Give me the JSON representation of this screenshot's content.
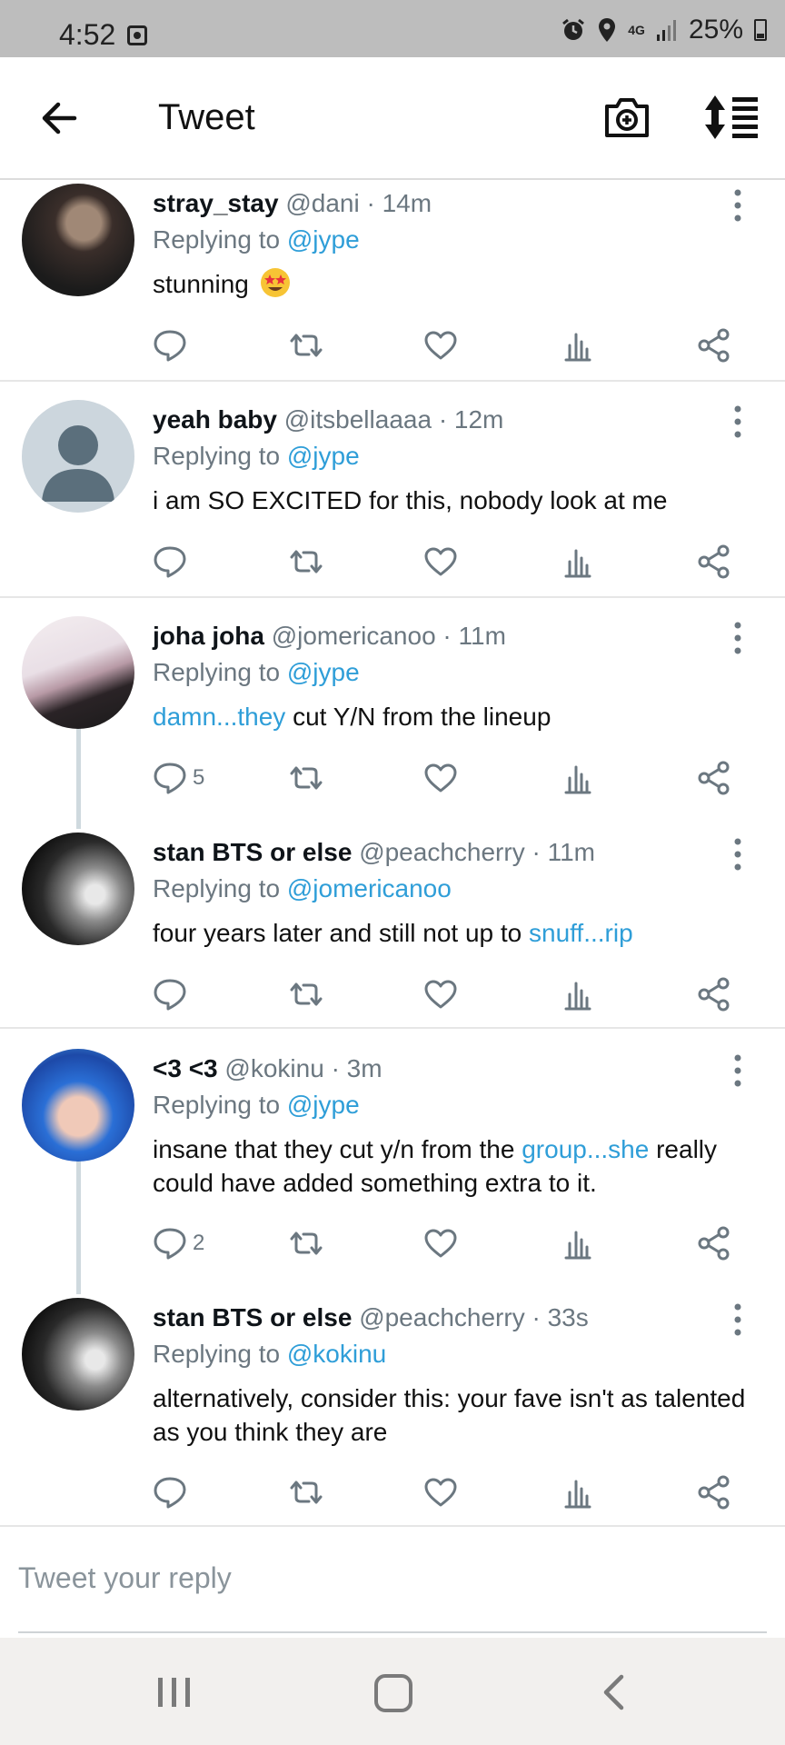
{
  "status_bar": {
    "time": "4:52",
    "network": "4G",
    "battery": "25%"
  },
  "header": {
    "title": "Tweet"
  },
  "tweets": [
    {
      "name": "stray_stay",
      "meta": "@dani · 14m",
      "replying_prefix": "Replying to ",
      "replying_to": "@jype",
      "text": "stunning",
      "emoji": "star-struck-emoji",
      "reply_count": ""
    },
    {
      "name": "yeah baby",
      "meta": "@itsbellaaaa · 12m",
      "replying_prefix": "Replying to ",
      "replying_to": "@jype",
      "text": "i am SO EXCITED for this, nobody look at me",
      "reply_count": ""
    },
    {
      "name": "joha joha",
      "meta": "@jomericanoo · 11m",
      "replying_prefix": "Replying to ",
      "replying_to": "@jype",
      "text_link": "damn...they",
      "text": " cut Y/N from the lineup",
      "reply_count": "5"
    },
    {
      "name": "stan BTS or else",
      "meta": "@peachcherry · 11m",
      "replying_prefix": "Replying to ",
      "replying_to": "@jomericanoo",
      "text": "four years later and still not up to ",
      "text_link": "snuff...rip",
      "reply_count": ""
    },
    {
      "name": "<3 <3",
      "meta": "@kokinu · 3m",
      "replying_prefix": "Replying to ",
      "replying_to": "@jype",
      "text": "insane that they cut y/n from the ",
      "text_link": "group...she",
      "text_after": " really could have added something extra to it.",
      "reply_count": "2"
    },
    {
      "name": "stan BTS or else",
      "meta": "@peachcherry · 33s",
      "replying_prefix": "Replying to ",
      "replying_to": "@kokinu",
      "text": "alternatively, consider this: your fave isn't as talented as you think they are",
      "reply_count": ""
    }
  ],
  "reply_box": {
    "placeholder": "Tweet your reply"
  },
  "colors": {
    "accent": "#2f9ed8",
    "icon_gray": "#6b7780",
    "status_bar": "#bdbdbd",
    "nav_bar": "#f2f0ee"
  }
}
